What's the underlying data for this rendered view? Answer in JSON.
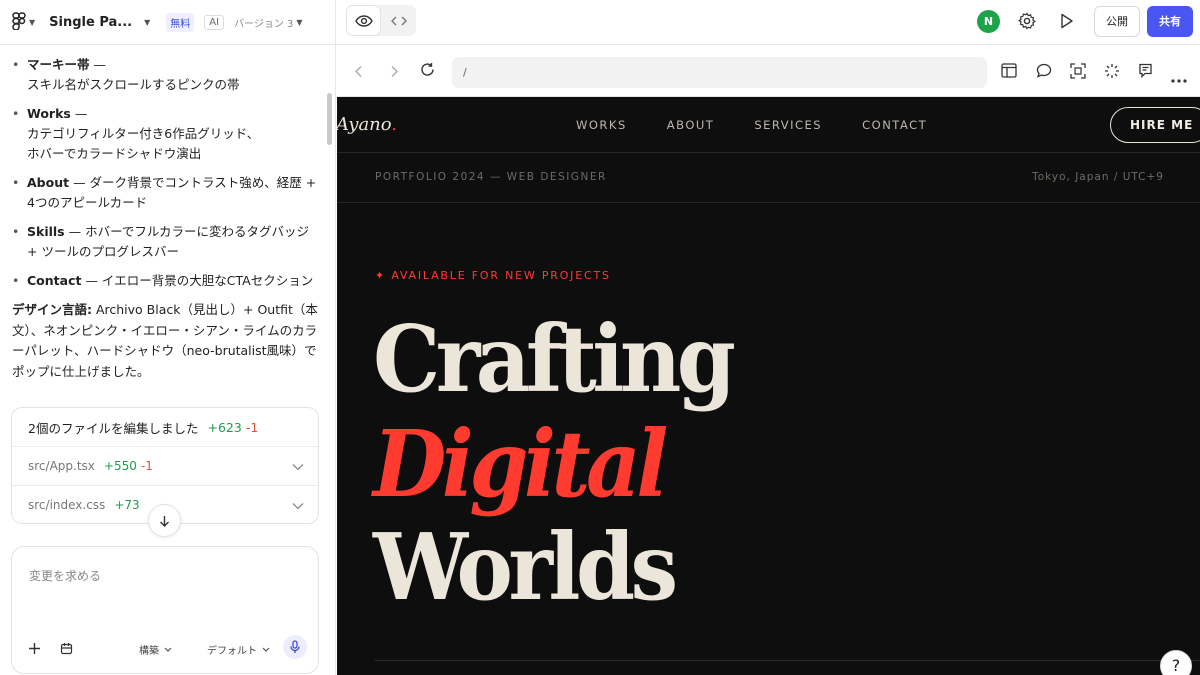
{
  "topbar": {
    "project_title": "Single Pa...",
    "badge_free": "無料",
    "badge_ai": "AI",
    "version": "バージョン 3",
    "avatar": "N",
    "publish_label": "公開",
    "share_label": "共有"
  },
  "chat": {
    "bullets": [
      {
        "title": "マーキー帯",
        "text": " —",
        "text2": "スキル名がスクロールするピンクの帯"
      },
      {
        "title": "Works",
        "text": " —",
        "text2": "カテゴリフィルター付き6作品グリッド、",
        "text3": "ホバーでカラードシャドウ演出"
      },
      {
        "title": "About",
        "text": " — ダーク背景でコントラスト強め、経歴 + 4つのアピールカード"
      },
      {
        "title": "Skills",
        "text": " — ホバーでフルカラーに変わるタグバッジ + ツールのプログレスバー"
      },
      {
        "title": "Contact",
        "text": " — イエロー背景の大胆なCTAセクション"
      }
    ],
    "design_title": "デザイン言語:",
    "design_text": " Archivo Black（見出し）+ Outfit（本文）、ネオンピンク・イエロー・シアン・ライムのカラーパレット、ハードシャドウ（neo-brutalist風味）でポップに仕上げました。"
  },
  "files": {
    "header": "2個のファイルを編集しました",
    "header_add": "+623",
    "header_del": "-1",
    "rows": [
      {
        "name": "src/App.tsx",
        "add": "+550",
        "del": "-1"
      },
      {
        "name": "src/index.css",
        "add": "+73"
      }
    ]
  },
  "composer": {
    "placeholder": "変更を求める",
    "mode": "構築",
    "model": "デフォルト"
  },
  "browser": {
    "url": "/"
  },
  "preview": {
    "logo": "Ayano",
    "logo_dot": ".",
    "nav": [
      "WORKS",
      "ABOUT",
      "SERVICES",
      "CONTACT"
    ],
    "hire": "HIRE ME",
    "meta_left": "PORTFOLIO 2024 — WEB DESIGNER",
    "meta_right": "Tokyo, Japan / UTC+9",
    "available": "✦ AVAILABLE FOR NEW PROJECTS",
    "headline": [
      "Crafting",
      "Digital",
      "Worlds"
    ]
  },
  "help": "?",
  "colors": {
    "accent": "#4b56f2",
    "preview_bg": "#0f0e0e",
    "preview_red": "#ff3b30",
    "preview_cream": "#ece6da"
  }
}
